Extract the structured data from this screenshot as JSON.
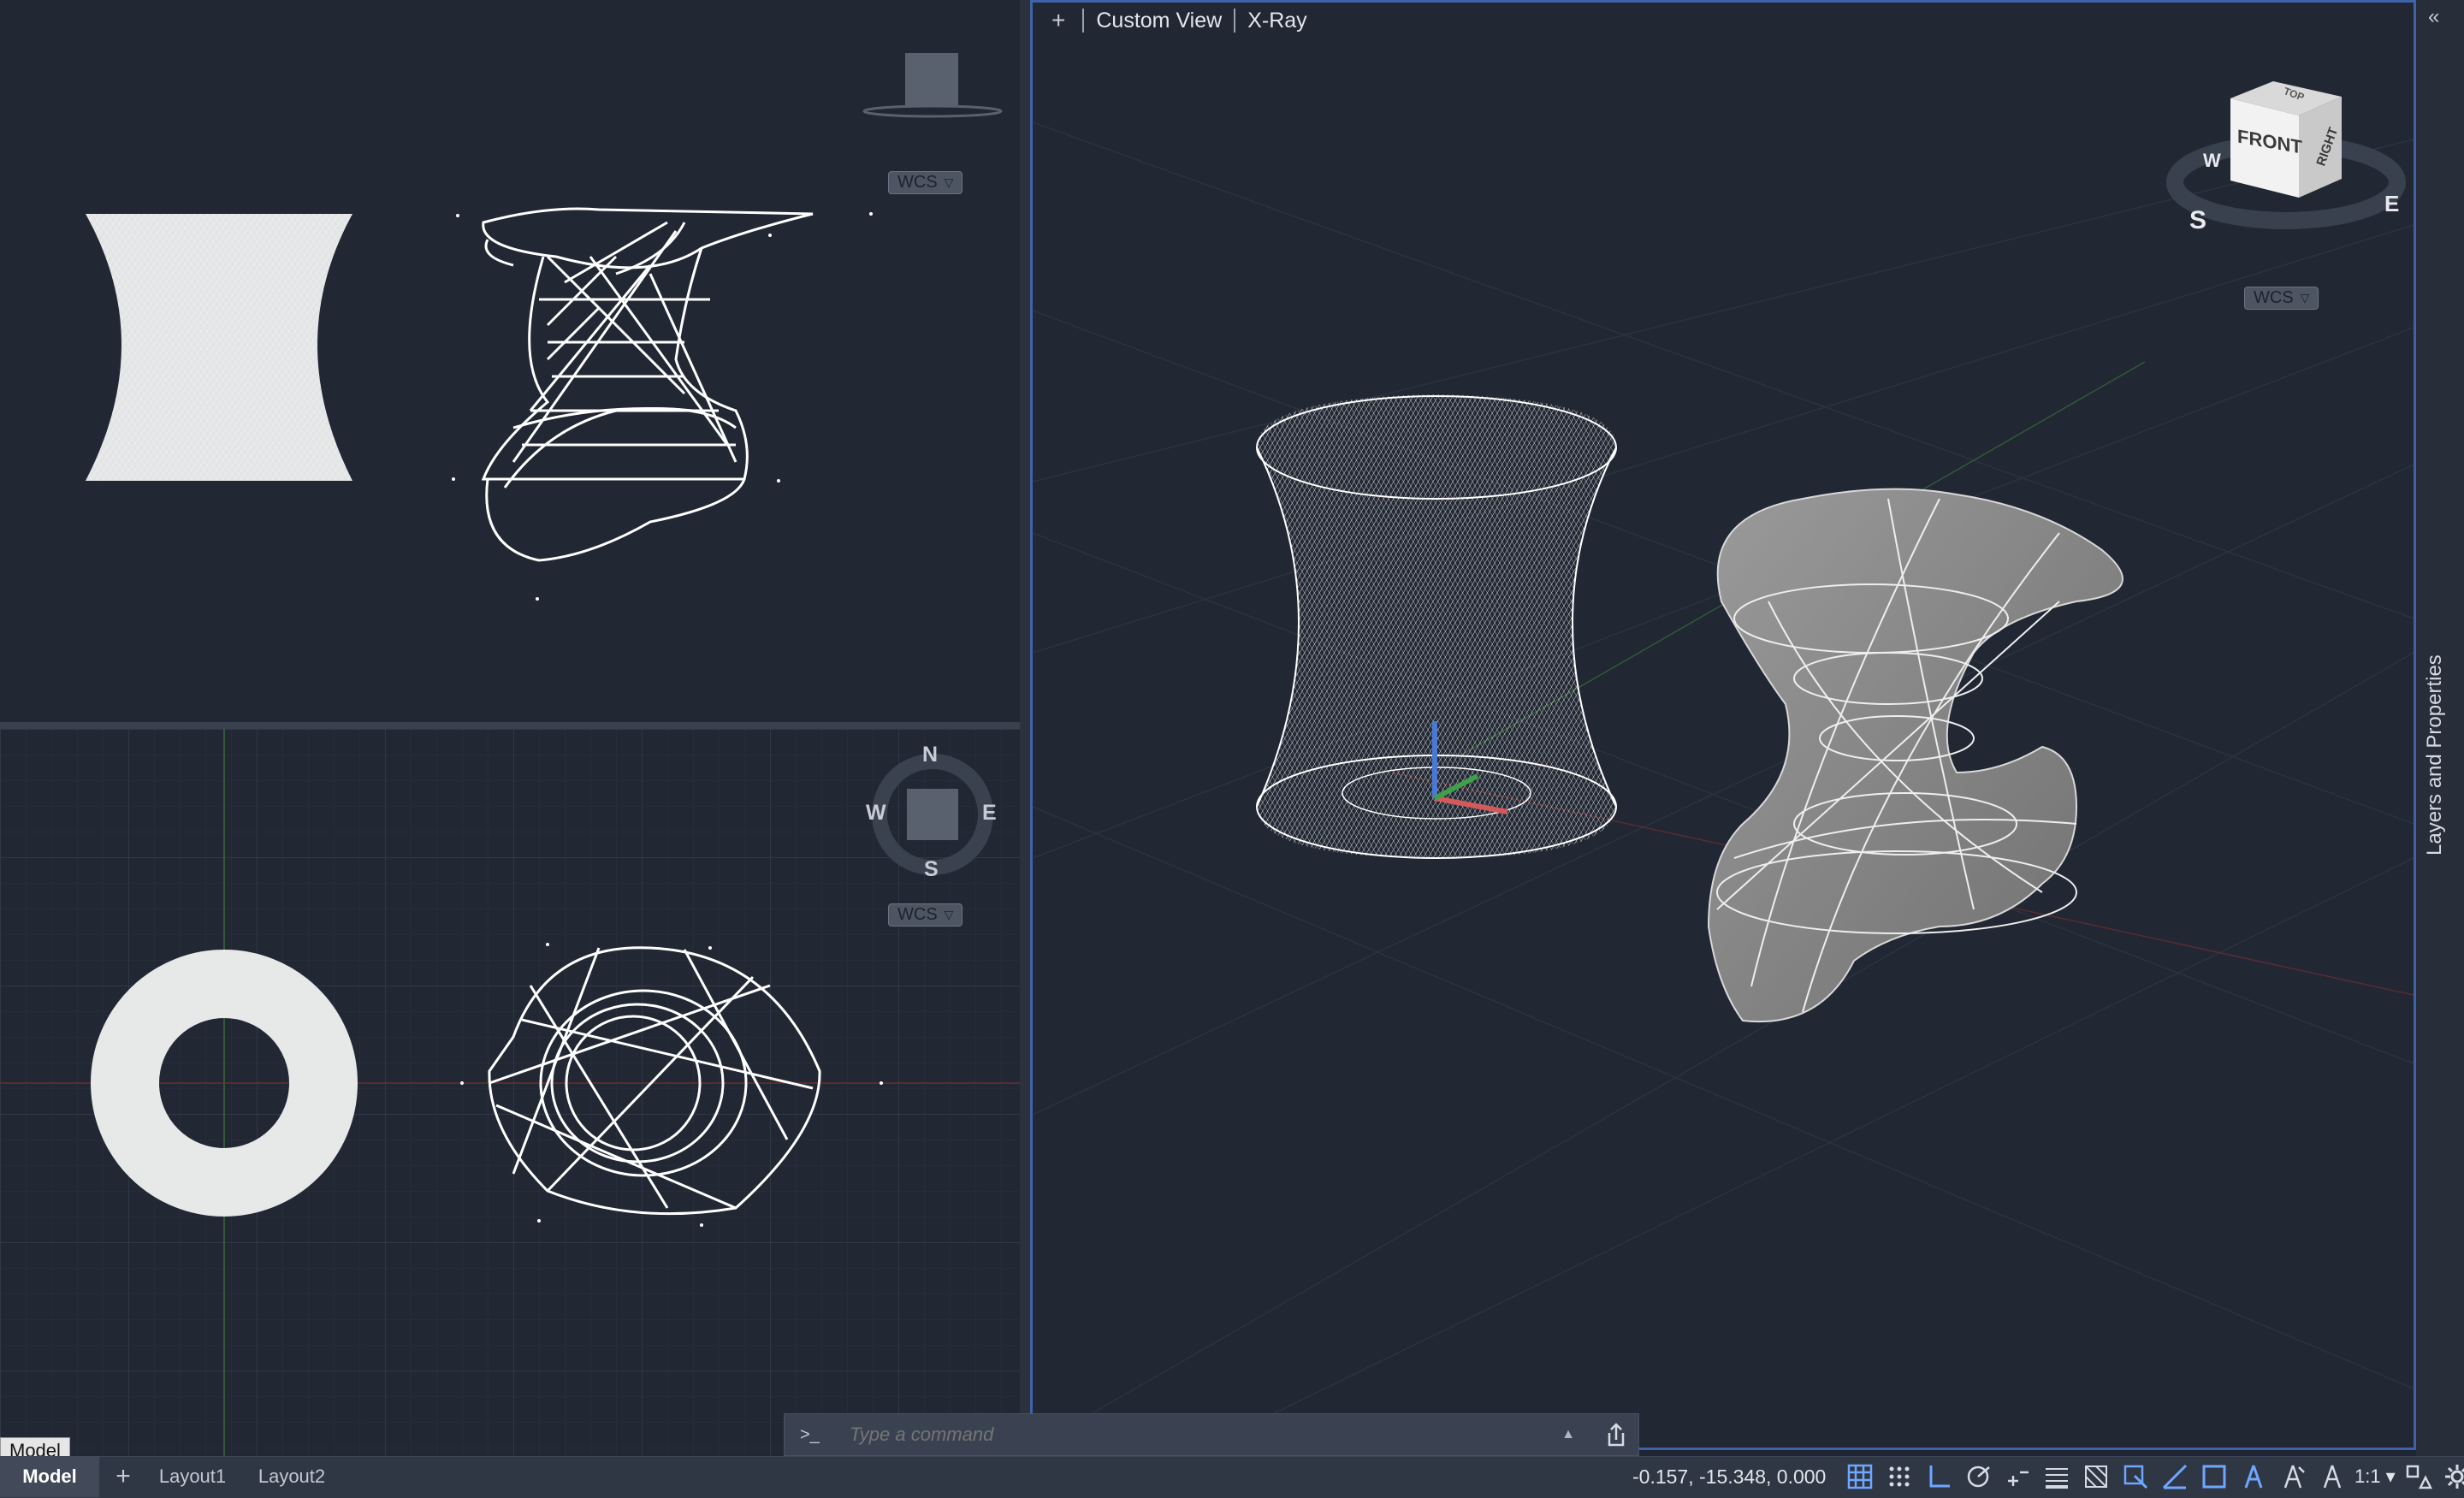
{
  "viewports": {
    "perspective": {
      "plus": "+",
      "view": "Custom View",
      "style": "X-Ray"
    },
    "wcs_label": "WCS",
    "compass": {
      "n": "N",
      "s": "S",
      "e": "E",
      "w": "W"
    },
    "viewcube": {
      "front": "FRONT",
      "right": "RIGHT",
      "top": "TOP"
    }
  },
  "side_panel": {
    "title": "Layers and Properties",
    "collapse": "«"
  },
  "command": {
    "prompt": ">_",
    "placeholder": "Type a command"
  },
  "tabs": {
    "tooltip": "Model",
    "model": "Model",
    "add": "+",
    "layout1": "Layout1",
    "layout2": "Layout2"
  },
  "status": {
    "coordinates": "-0.157,  -15.348, 0.000",
    "scale": "1:1"
  },
  "colors": {
    "accent": "#3f63a8",
    "background": "#212733"
  }
}
